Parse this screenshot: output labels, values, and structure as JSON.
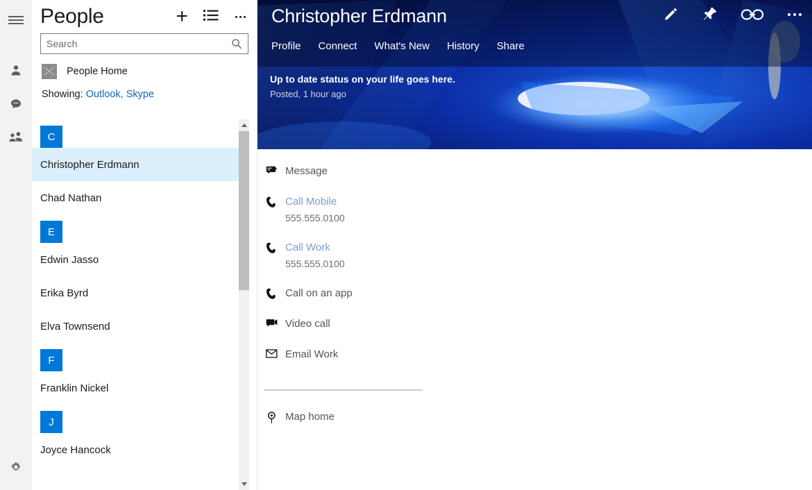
{
  "rail": {
    "menu_label": "hamburger-menu",
    "items": [
      {
        "name": "person-icon",
        "label": "Me"
      },
      {
        "name": "chat-bubble-icon",
        "label": "Skype"
      },
      {
        "name": "people-icon",
        "label": "Contacts"
      }
    ],
    "settings_label": "Settings"
  },
  "list_pane": {
    "title": "People",
    "add_label": "+",
    "view_list_label": "List view",
    "more_label": "More",
    "search": {
      "placeholder": "Search",
      "value": ""
    },
    "people_home": "People Home",
    "showing_label": "Showing:",
    "showing_sources": "Outlook, Skype",
    "groups": [
      {
        "letter": "C",
        "contacts": [
          "Christopher Erdmann",
          "Chad Nathan"
        ]
      },
      {
        "letter": "E",
        "contacts": [
          "Edwin Jasso",
          "Erika Byrd",
          "Elva Townsend"
        ]
      },
      {
        "letter": "F",
        "contacts": [
          "Franklin Nickel"
        ]
      },
      {
        "letter": "J",
        "contacts": [
          "Joyce Hancock"
        ]
      }
    ],
    "selected_contact": "Christopher Erdmann"
  },
  "detail": {
    "contact_name": "Christopher Erdmann",
    "header_icons": [
      {
        "name": "edit-pencil-icon",
        "label": "Edit"
      },
      {
        "name": "pin-icon",
        "label": "Pin"
      },
      {
        "name": "link-icon",
        "label": "Link contacts"
      },
      {
        "name": "more-ellipsis-icon",
        "label": "More"
      }
    ],
    "tabs": [
      {
        "label": "Profile",
        "selected": true
      },
      {
        "label": "Connect",
        "selected": false
      },
      {
        "label": "What's New",
        "selected": false
      },
      {
        "label": "History",
        "selected": false
      },
      {
        "label": "Share",
        "selected": false
      }
    ],
    "status": {
      "text": "Up to date status on your life goes here.",
      "meta": "Posted, 1 hour ago"
    },
    "actions": [
      {
        "icon": "message-icon",
        "label": "Message",
        "sub": "",
        "link": false
      },
      {
        "icon": "phone-icon",
        "label": "Call Mobile",
        "sub": "555.555.0100",
        "link": true
      },
      {
        "icon": "phone-icon",
        "label": "Call Work",
        "sub": "555.555.0100",
        "link": true
      },
      {
        "icon": "phone-icon",
        "label": "Call on an app",
        "sub": "",
        "link": false
      },
      {
        "icon": "video-camera-icon",
        "label": "Video call",
        "sub": "",
        "link": false
      },
      {
        "icon": "envelope-icon",
        "label": "Email Work",
        "sub": "",
        "link": false
      }
    ],
    "map_action": {
      "icon": "map-pin-icon",
      "label": "Map home"
    }
  },
  "colors": {
    "accent": "#0078d7",
    "selection": "#dbeffc",
    "link": "#1464b4",
    "rail_bg": "#f2f2f2",
    "hero_blue": "#0a1f6e"
  }
}
